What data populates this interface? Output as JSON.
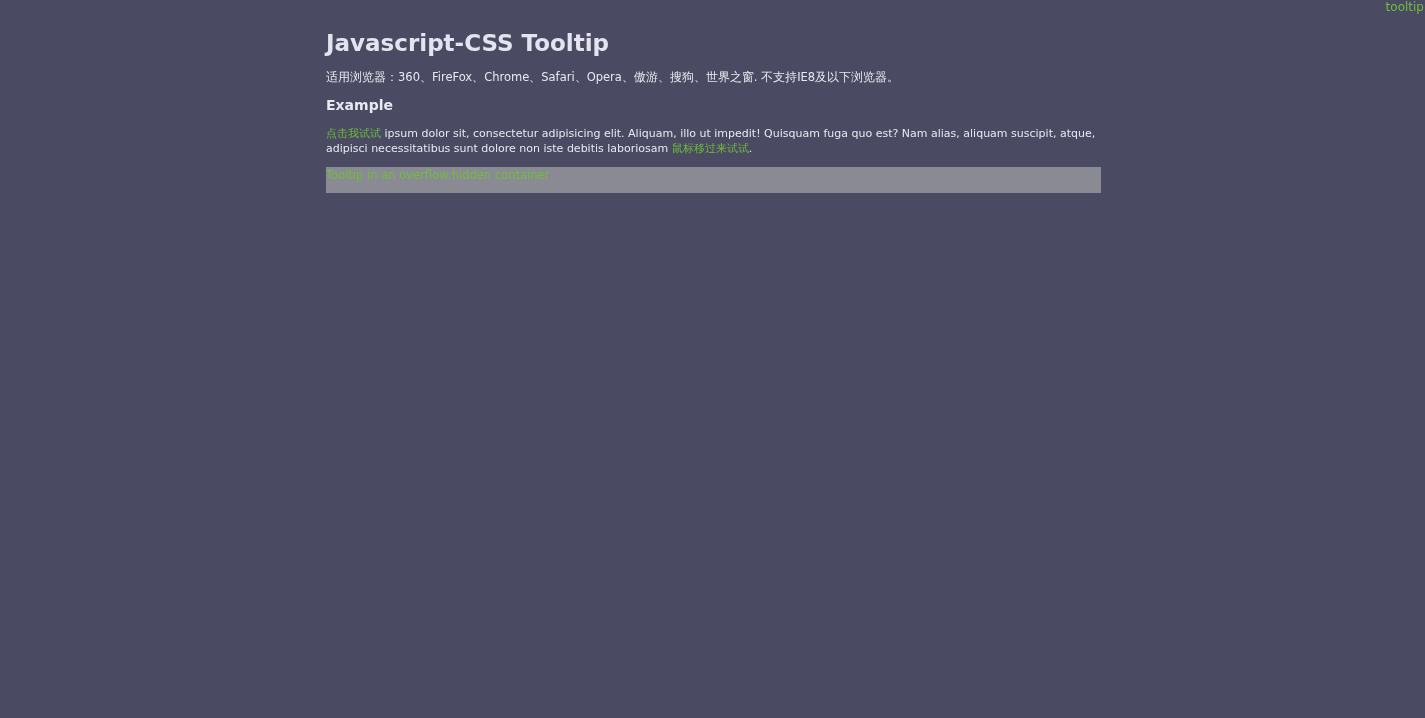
{
  "corner_link": "tooltip",
  "title": "Javascript-CSS Tooltip",
  "browser_note": "适用浏览器：360、FireFox、Chrome、Safari、Opera、傲游、搜狗、世界之窗. 不支持IE8及以下浏览器。",
  "section_heading": "Example",
  "paragraph": [
    {
      "kind": "link",
      "text": "点击我试试"
    },
    {
      "kind": "text",
      "text": " ipsum dolor sit, consectetur adipisicing elit. Aliquam, illo ut impedit! Quisquam fuga quo est? Nam alias, aliquam suscipit, atque, adipisci necessitatibus sunt dolore non iste debitis laboriosam "
    },
    {
      "kind": "link",
      "text": "鼠标移过来试试"
    },
    {
      "kind": "text",
      "text": "."
    }
  ],
  "container_link": "Tooltip in an overflow:hidden container"
}
